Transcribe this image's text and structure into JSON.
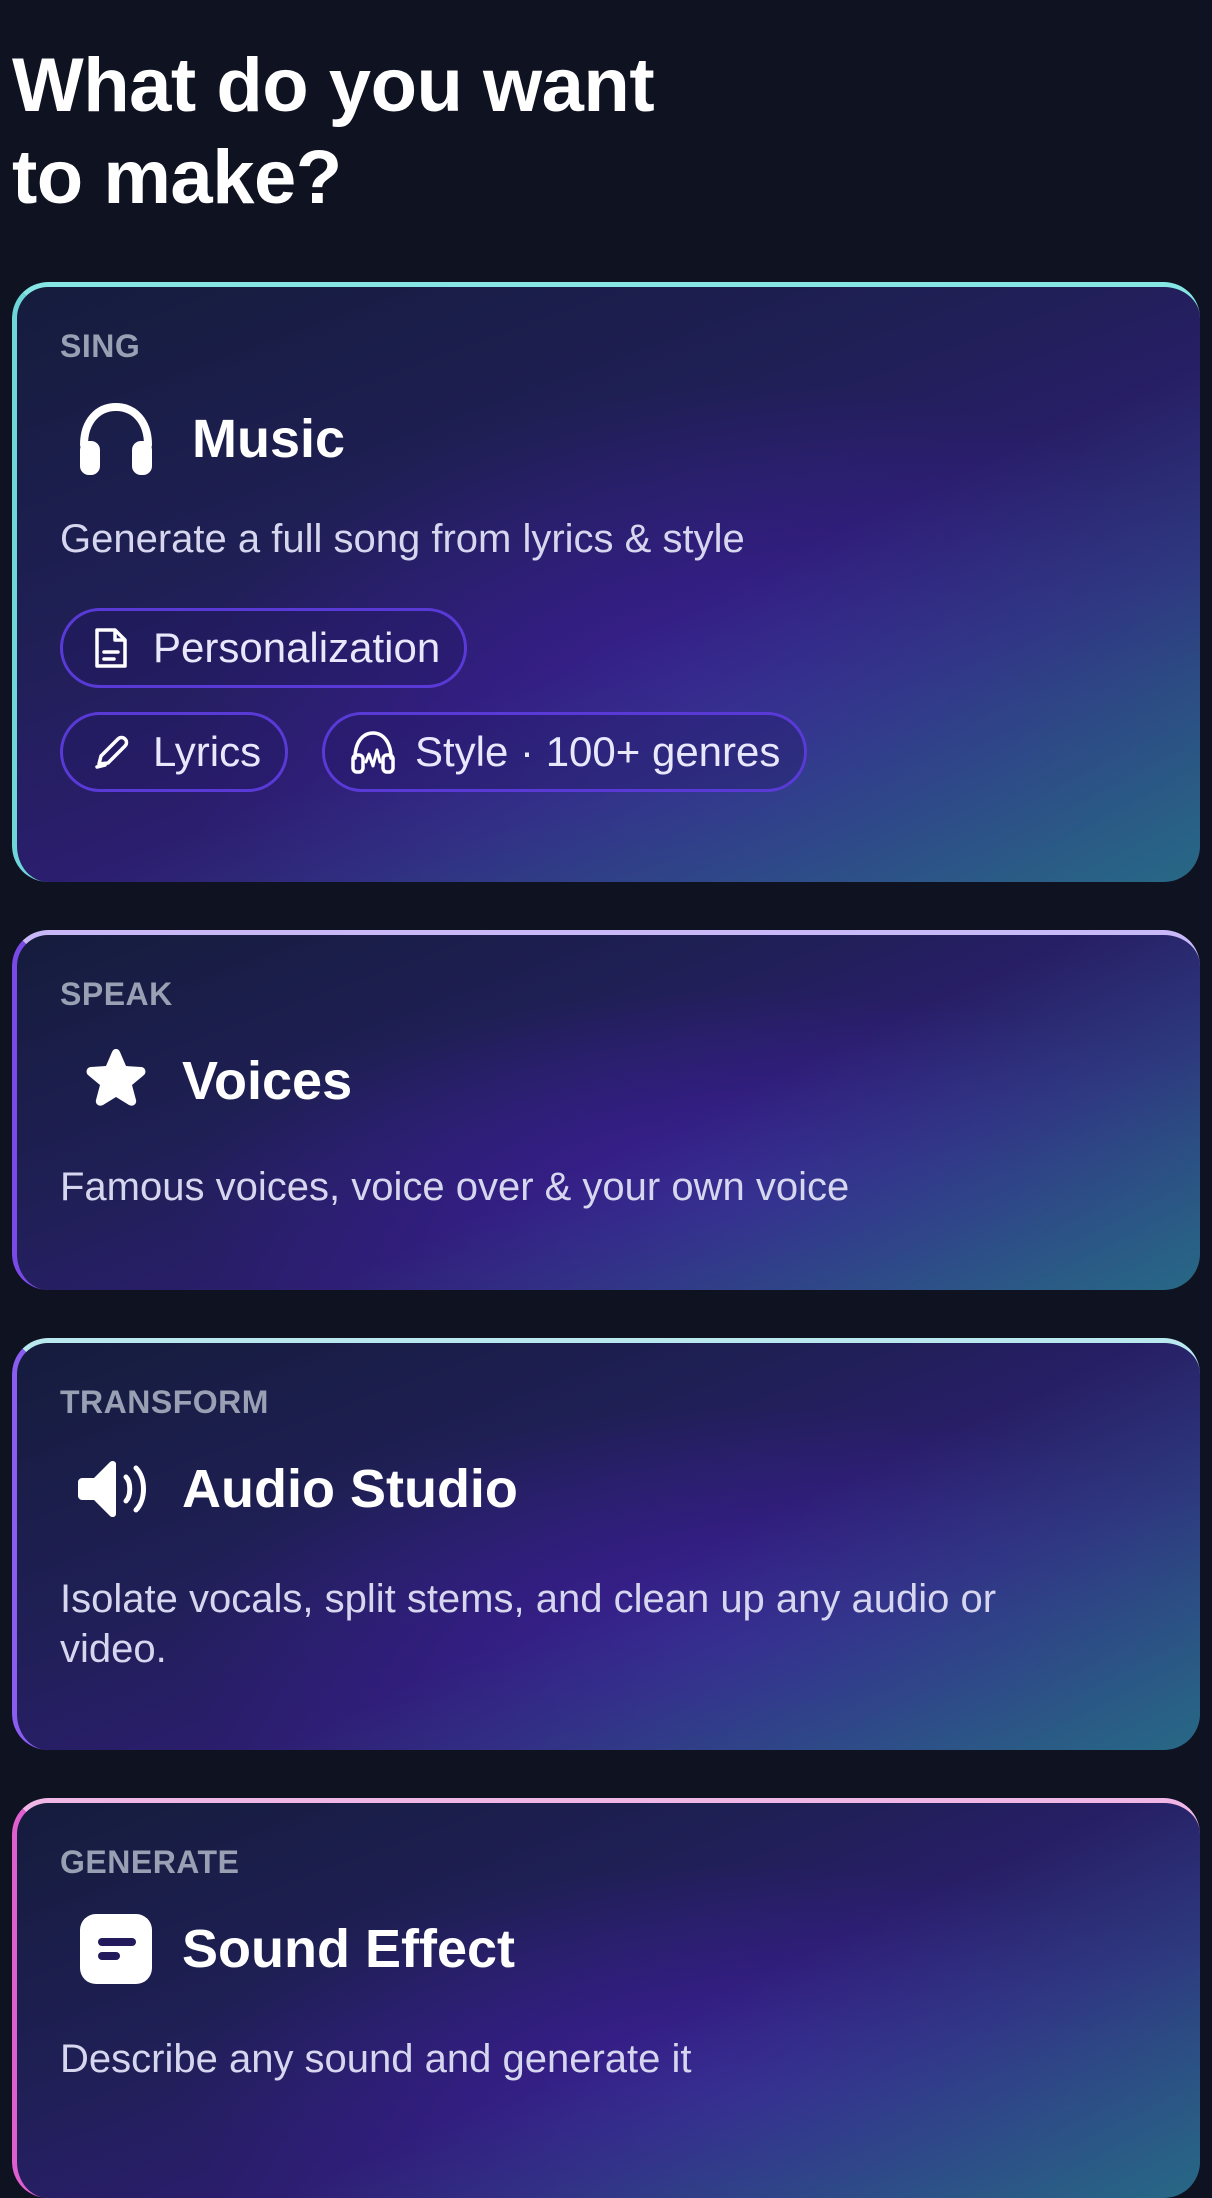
{
  "page": {
    "title": "What do you want\nto make?"
  },
  "cards": [
    {
      "category": "SING",
      "title": "Music",
      "icon": "headphones-icon",
      "description": "Generate a full song from lyrics & style",
      "chips": [
        {
          "label": "Personalization",
          "icon": "document-icon"
        },
        {
          "label": "Lyrics",
          "icon": "pencil-icon"
        },
        {
          "label": "Style · 100+ genres",
          "icon": "headphones-waveform-icon"
        }
      ]
    },
    {
      "category": "SPEAK",
      "title": "Voices",
      "icon": "star-icon",
      "description": "Famous voices, voice over & your own voice"
    },
    {
      "category": "TRANSFORM",
      "title": "Audio Studio",
      "icon": "speaker-icon",
      "description": "Isolate vocals, split stems, and clean up any audio or video."
    },
    {
      "category": "GENERATE",
      "title": "Sound Effect",
      "icon": "sound-effect-icon",
      "description": "Describe any sound and generate it"
    }
  ],
  "colors": {
    "background": "#0f1221",
    "chip_border": "#5a3ad6",
    "category_text": "#9aa0b4",
    "description_text": "#d7d6ef"
  }
}
